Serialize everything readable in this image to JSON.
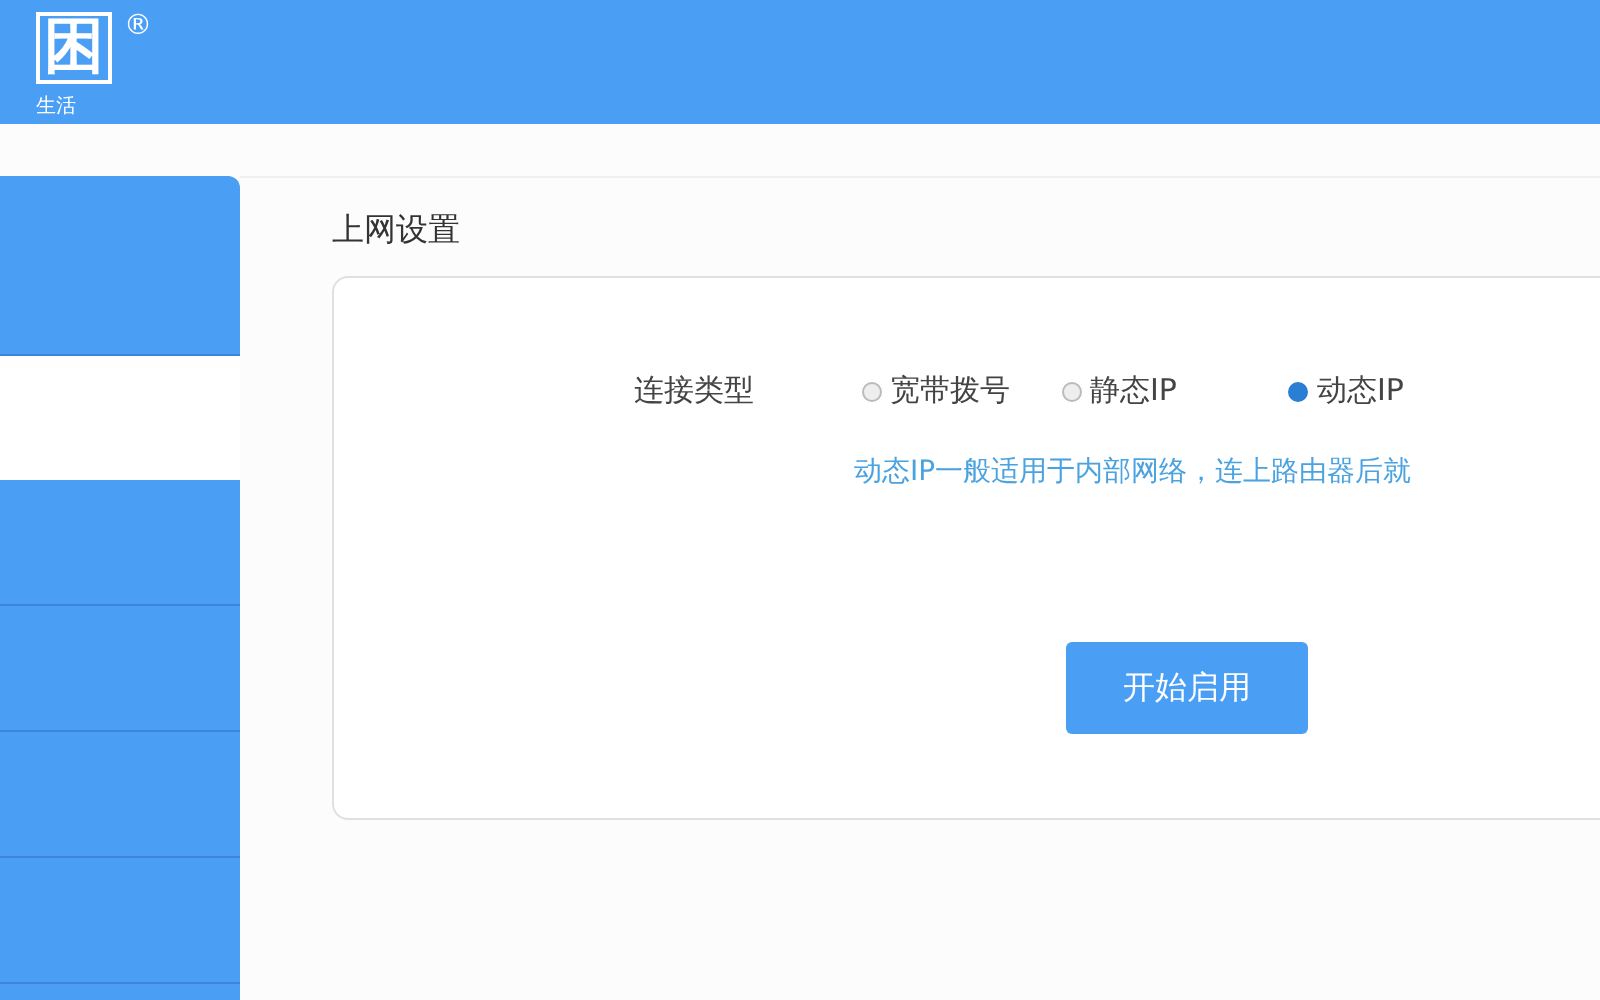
{
  "header": {
    "logo": {
      "text": "困",
      "mark": "®",
      "tagline": "生活"
    }
  },
  "sidebar": {
    "items": [
      {
        "selected": false
      },
      {
        "selected": true
      },
      {
        "selected": false
      },
      {
        "selected": false
      },
      {
        "selected": false
      },
      {
        "selected": false
      },
      {
        "selected": false
      }
    ]
  },
  "section": {
    "title": "上网设置"
  },
  "form": {
    "label": "连接类型",
    "options": [
      {
        "label": "宽带拨号",
        "selected": false
      },
      {
        "label": "静态IP",
        "selected": false
      },
      {
        "label": "动态IP",
        "selected": true
      }
    ],
    "hint": "动态IP一般适用于内部网络，连上路由器后就"
  },
  "buttons": [
    "开始启用"
  ]
}
